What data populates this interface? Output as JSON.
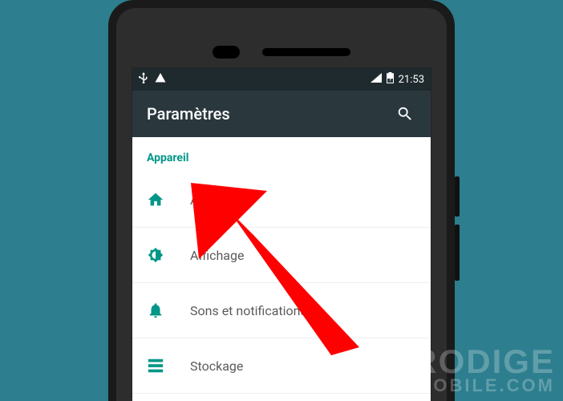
{
  "statusbar": {
    "time": "21:53"
  },
  "appbar": {
    "title": "Paramètres"
  },
  "section": {
    "header": "Appareil",
    "items": [
      {
        "label": "Accueil"
      },
      {
        "label": "Affichage"
      },
      {
        "label": "Sons et notifications"
      },
      {
        "label": "Stockage"
      }
    ]
  },
  "watermark": {
    "line1": "PRODIGE",
    "line2": "MOBILE.COM"
  },
  "colors": {
    "accent": "#009688",
    "arrow": "#ff0000"
  }
}
